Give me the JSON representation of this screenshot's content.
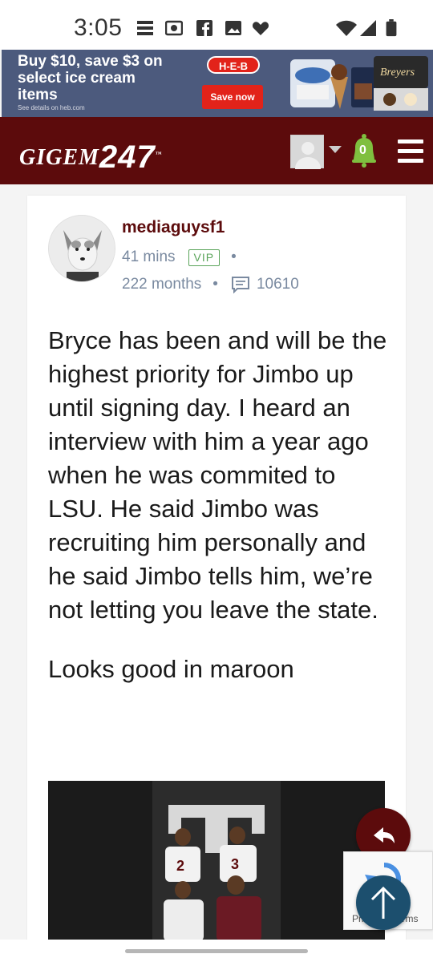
{
  "status_bar": {
    "time": "3:05"
  },
  "ad": {
    "headline": "Buy $10, save $3 on select ice cream items",
    "fine_print": "See details on heb.com",
    "brand": "H-E-B",
    "cta": "Save now"
  },
  "site": {
    "brand_text": "GIGEM",
    "brand_number": "247",
    "notification_count": "0",
    "accent_color": "#5c0b0c"
  },
  "post": {
    "author": "mediaguysf1",
    "time_ago": "41 mins",
    "badge": "VIP",
    "tenure": "222 months",
    "post_count": "10610",
    "paragraphs": [
      "Bryce has been and will be the highest priority for Jimbo up until signing day. I heard an interview with him a year ago when he was commited to LSU. He said Jimbo was recruiting him personally and he said Jimbo tells him, we’re not letting you leave the state.",
      "Looks good in maroon"
    ]
  },
  "recaptcha": {
    "text": "Privacy - Terms"
  }
}
